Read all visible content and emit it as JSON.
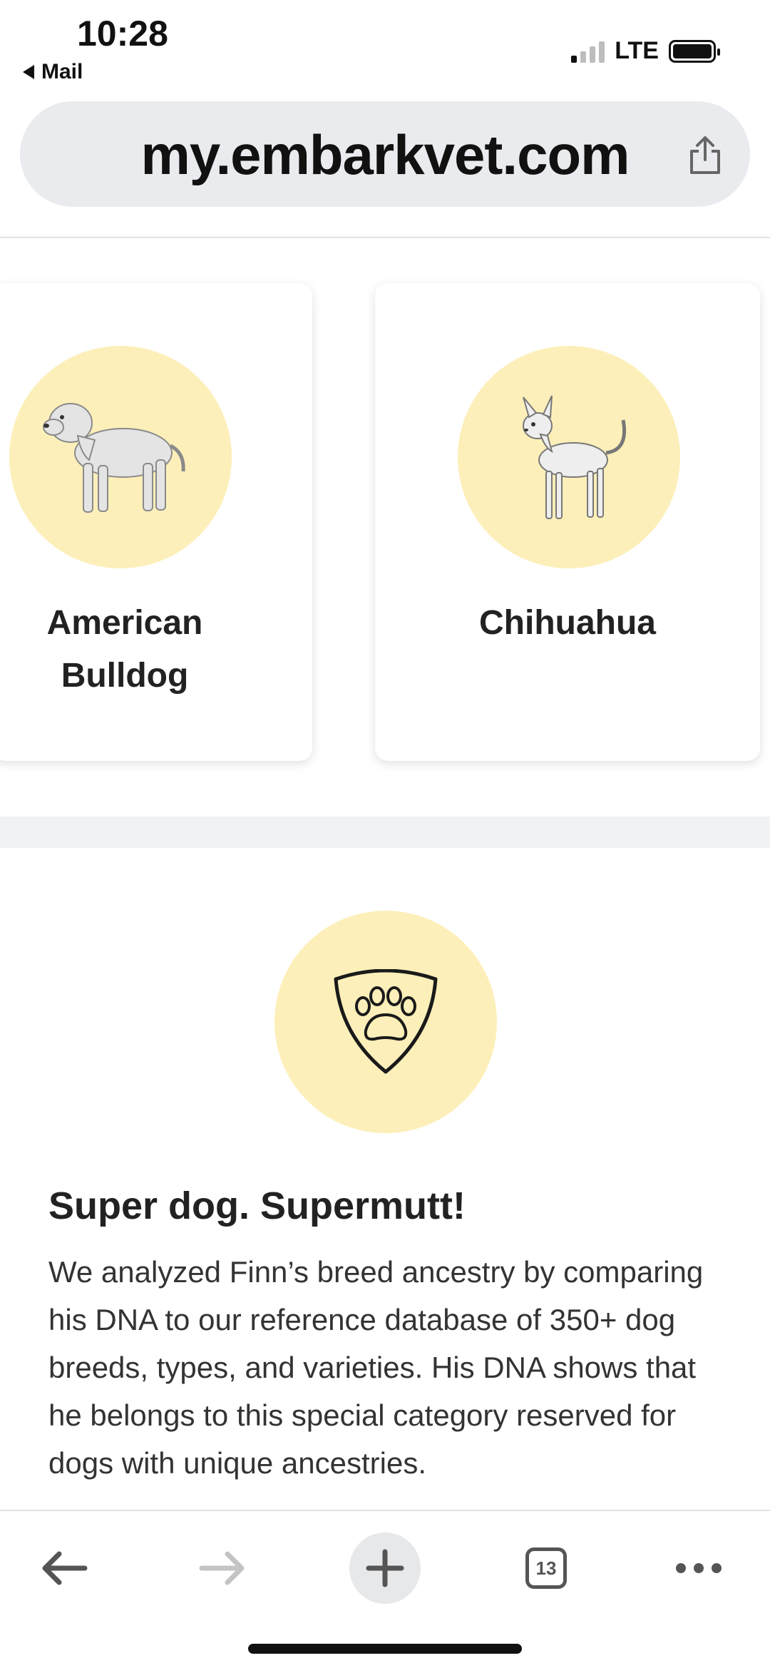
{
  "status_bar": {
    "time": "10:28",
    "back_app": "Mail",
    "network": "LTE"
  },
  "browser": {
    "url": "my.embarkvet.com",
    "tab_count": "13"
  },
  "breeds": [
    {
      "name": "American Bulldog"
    },
    {
      "name": "Chihuahua"
    }
  ],
  "supermutt": {
    "title": "Super dog. Supermutt!",
    "body": "We analyzed Finn’s breed ancestry by comparing his DNA to our reference database of 350+ dog breeds, types, and varieties. His DNA shows that he belongs to this special category reserved for dogs with unique ancestries."
  },
  "colors": {
    "circle_bg": "#fdefb9",
    "url_bar_bg": "#e9ebee",
    "text_dark": "#222222"
  },
  "icons": [
    "back-arrow-icon",
    "forward-arrow-icon",
    "plus-icon",
    "tabs-icon",
    "more-icon",
    "share-icon",
    "shield-paw-icon"
  ]
}
